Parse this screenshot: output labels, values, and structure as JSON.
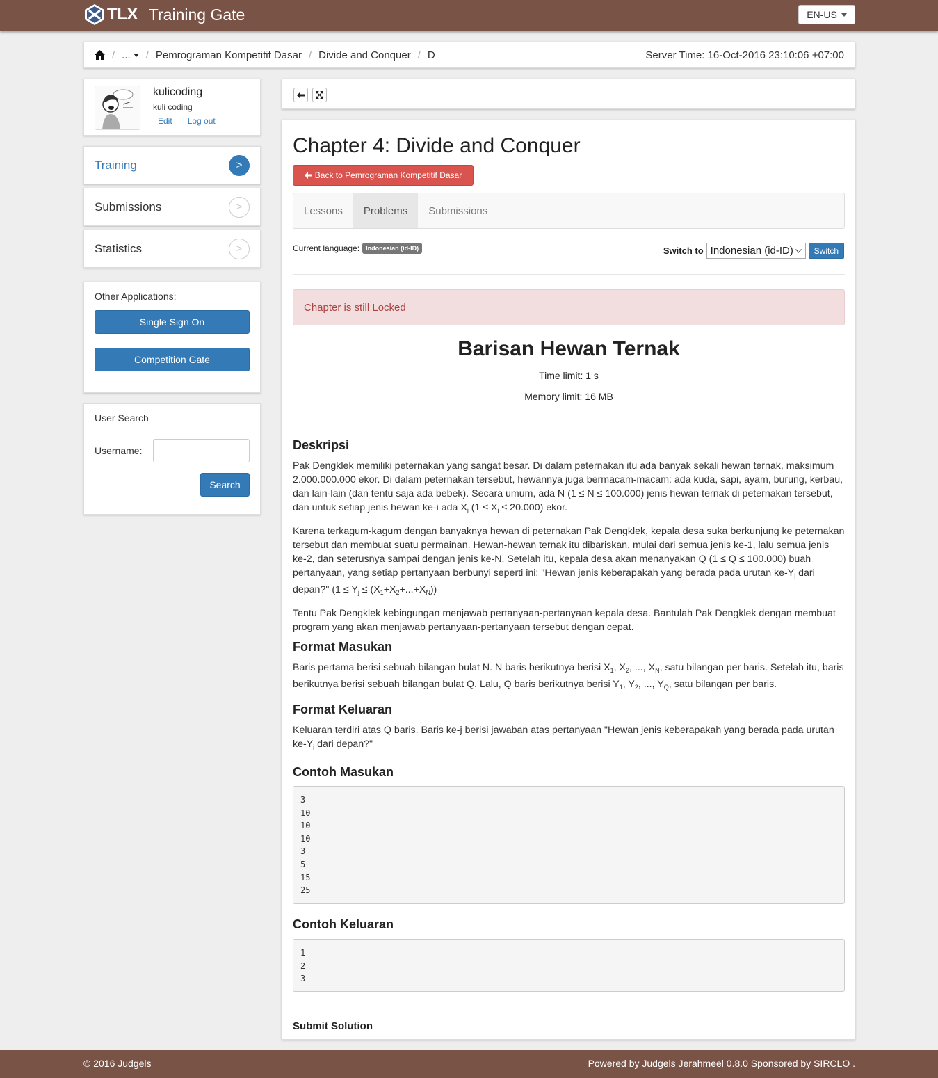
{
  "header": {
    "logo_text": "TLX",
    "app_name": "Training Gate",
    "language": "EN-US",
    "brand_color": "#7a5347"
  },
  "breadcrumb": {
    "items": [
      "...",
      "Pemrograman Kompetitif Dasar",
      "Divide and Conquer",
      "D"
    ],
    "server_time": "Server Time: 16-Oct-2016 23:10:06 +07:00"
  },
  "user": {
    "username": "kulicoding",
    "fullname": "kuli coding",
    "edit_label": "Edit",
    "logout_label": "Log out"
  },
  "sidebar": {
    "items": [
      {
        "label": "Training",
        "active": true
      },
      {
        "label": "Submissions",
        "active": false
      },
      {
        "label": "Statistics",
        "active": false
      }
    ],
    "arrow": ">",
    "other_apps_title": "Other Applications:",
    "sso_label": "Single Sign On",
    "competition_label": "Competition Gate"
  },
  "user_search": {
    "title": "User Search",
    "username_label": "Username:",
    "username_value": "",
    "search_label": "Search"
  },
  "main": {
    "chapter_title": "Chapter 4: Divide and Conquer",
    "back_label": "Back to Pemrograman Kompetitif Dasar",
    "tabs": [
      {
        "label": "Lessons",
        "active": false
      },
      {
        "label": "Problems",
        "active": true
      },
      {
        "label": "Submissions",
        "active": false
      }
    ],
    "current_language_label": "Current language:",
    "current_language": "Indonesian (id-ID)",
    "switch_to_label": "Switch to",
    "switch_select_value": "Indonesian (id-ID)",
    "switch_button": "Switch",
    "alert": "Chapter is still Locked"
  },
  "problem": {
    "title": "Barisan Hewan Ternak",
    "time_limit": "Time limit: 1 s",
    "memory_limit": "Memory limit: 16 MB",
    "desc_heading": "Deskripsi",
    "desc_p1": "Pak Dengklek memiliki peternakan yang sangat besar. Di dalam peternakan itu ada banyak sekali hewan ternak, maksimum 2.000.000.000 ekor. Di dalam peternakan tersebut, hewannya juga bermacam-macam: ada kuda, sapi, ayam, burung, kerbau, dan lain-lain (dan tentu saja ada bebek). Secara umum, ada N (1 ≤ N ≤ 100.000) jenis hewan ternak di peternakan tersebut, dan untuk setiap jenis hewan ke-i ada X",
    "desc_p1_sub1": "i",
    "desc_p1_mid": " (1 ≤ X",
    "desc_p1_sub2": "i",
    "desc_p1_end": " ≤ 20.000) ekor.",
    "desc_p2_a": "Karena terkagum-kagum dengan banyaknya hewan di peternakan Pak Dengklek, kepala desa suka berkunjung ke peternakan tersebut dan membuat suatu permainan. Hewan-hewan ternak itu dibariskan, mulai dari semua jenis ke-1, lalu semua jenis ke-2, dan seterusnya sampai dengan jenis ke-N. Setelah itu, kepala desa akan menanyakan Q (1 ≤ Q ≤ 100.000) buah pertanyaan, yang setiap pertanyaan berbunyi seperti ini: \"Hewan jenis keberapakah yang berada pada urutan ke-Y",
    "desc_p2_sub": "j",
    "desc_p2_b": " dari depan?\" (1 ≤ Y",
    "desc_p2_c": " ≤ (X",
    "desc_p2_s1": "1",
    "desc_p2_d": "+X",
    "desc_p2_s2": "2",
    "desc_p2_e": "+...+X",
    "desc_p2_sN": "N",
    "desc_p2_f": "))",
    "desc_p3": "Tentu Pak Dengklek kebingungan menjawab pertanyaan-pertanyaan kepala desa. Bantulah Pak Dengklek dengan membuat program yang akan menjawab pertanyaan-pertanyaan tersebut dengan cepat.",
    "input_heading": "Format Masukan",
    "input_a": "Baris pertama berisi sebuah bilangan bulat N. N baris berikutnya berisi X",
    "input_s1": "1",
    "input_b": ", X",
    "input_s2": "2",
    "input_c": ", ..., X",
    "input_sN": "N",
    "input_d": ", satu bilangan per baris. Setelah itu, baris berikutnya berisi sebuah bilangan bulat Q. Lalu, Q baris berikutnya berisi Y",
    "input_t1": "1",
    "input_e": ", Y",
    "input_t2": "2",
    "input_f": ", ..., Y",
    "input_tQ": "Q",
    "input_g": ", satu bilangan per baris.",
    "output_heading": "Format Keluaran",
    "output_a": "Keluaran terdiri atas Q baris. Baris ke-j berisi jawaban atas pertanyaan \"Hewan jenis keberapakah yang berada pada urutan ke-Y",
    "output_sub": "j",
    "output_b": " dari depan?\"",
    "sample_in_heading": "Contoh Masukan",
    "sample_in": [
      "3",
      "10",
      "10",
      "10",
      "3",
      "5",
      "15",
      "25"
    ],
    "sample_out_heading": "Contoh Keluaran",
    "sample_out": [
      "1",
      "2",
      "3"
    ],
    "submit_heading": "Submit Solution"
  },
  "footer": {
    "left": "© 2016 Judgels",
    "right": "Powered by Judgels Jerahmeel 0.8.0 Sponsored by SIRCLO ."
  }
}
